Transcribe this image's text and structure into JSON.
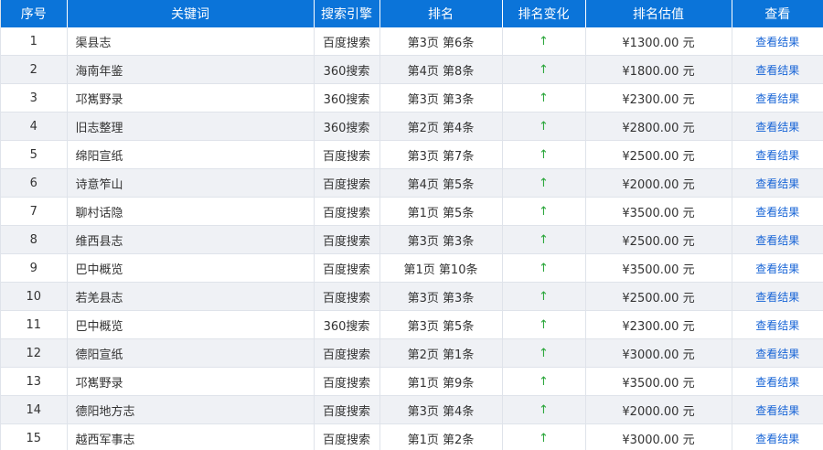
{
  "headers": {
    "index": "序号",
    "keyword": "关键词",
    "engine": "搜索引擎",
    "rank": "排名",
    "rank_change": "排名变化",
    "estimate": "排名估值",
    "view": "查看"
  },
  "colors": {
    "header_bg": "#0b74d9",
    "row_alt_bg": "#eff1f5",
    "arrow_up": "#2aa63a",
    "link": "#1764d6"
  },
  "rows": [
    {
      "index": "1",
      "keyword": "渠县志",
      "engine": "百度搜索",
      "rank": "第3页 第6条",
      "change": "↑",
      "estimate": "¥1300.00 元",
      "view": "查看结果"
    },
    {
      "index": "2",
      "keyword": "海南年鉴",
      "engine": "360搜索",
      "rank": "第4页 第8条",
      "change": "↑",
      "estimate": "¥1800.00 元",
      "view": "查看结果"
    },
    {
      "index": "3",
      "keyword": "邛嶲野录",
      "engine": "360搜索",
      "rank": "第3页 第3条",
      "change": "↑",
      "estimate": "¥2300.00 元",
      "view": "查看结果"
    },
    {
      "index": "4",
      "keyword": "旧志整理",
      "engine": "360搜索",
      "rank": "第2页 第4条",
      "change": "↑",
      "estimate": "¥2800.00 元",
      "view": "查看结果"
    },
    {
      "index": "5",
      "keyword": "绵阳宣纸",
      "engine": "百度搜索",
      "rank": "第3页 第7条",
      "change": "↑",
      "estimate": "¥2500.00 元",
      "view": "查看结果"
    },
    {
      "index": "6",
      "keyword": "诗意笮山",
      "engine": "百度搜索",
      "rank": "第4页 第5条",
      "change": "↑",
      "estimate": "¥2000.00 元",
      "view": "查看结果"
    },
    {
      "index": "7",
      "keyword": "聊村话隐",
      "engine": "百度搜索",
      "rank": "第1页 第5条",
      "change": "↑",
      "estimate": "¥3500.00 元",
      "view": "查看结果"
    },
    {
      "index": "8",
      "keyword": "维西县志",
      "engine": "百度搜索",
      "rank": "第3页 第3条",
      "change": "↑",
      "estimate": "¥2500.00 元",
      "view": "查看结果"
    },
    {
      "index": "9",
      "keyword": "巴中概览",
      "engine": "百度搜索",
      "rank": "第1页 第10条",
      "change": "↑",
      "estimate": "¥3500.00 元",
      "view": "查看结果"
    },
    {
      "index": "10",
      "keyword": "若羌县志",
      "engine": "百度搜索",
      "rank": "第3页 第3条",
      "change": "↑",
      "estimate": "¥2500.00 元",
      "view": "查看结果"
    },
    {
      "index": "11",
      "keyword": "巴中概览",
      "engine": "360搜索",
      "rank": "第3页 第5条",
      "change": "↑",
      "estimate": "¥2300.00 元",
      "view": "查看结果"
    },
    {
      "index": "12",
      "keyword": "德阳宣纸",
      "engine": "百度搜索",
      "rank": "第2页 第1条",
      "change": "↑",
      "estimate": "¥3000.00 元",
      "view": "查看结果"
    },
    {
      "index": "13",
      "keyword": "邛嶲野录",
      "engine": "百度搜索",
      "rank": "第1页 第9条",
      "change": "↑",
      "estimate": "¥3500.00 元",
      "view": "查看结果"
    },
    {
      "index": "14",
      "keyword": "德阳地方志",
      "engine": "百度搜索",
      "rank": "第3页 第4条",
      "change": "↑",
      "estimate": "¥2000.00 元",
      "view": "查看结果"
    },
    {
      "index": "15",
      "keyword": "越西军事志",
      "engine": "百度搜索",
      "rank": "第1页 第2条",
      "change": "↑",
      "estimate": "¥3000.00 元",
      "view": "查看结果"
    }
  ]
}
